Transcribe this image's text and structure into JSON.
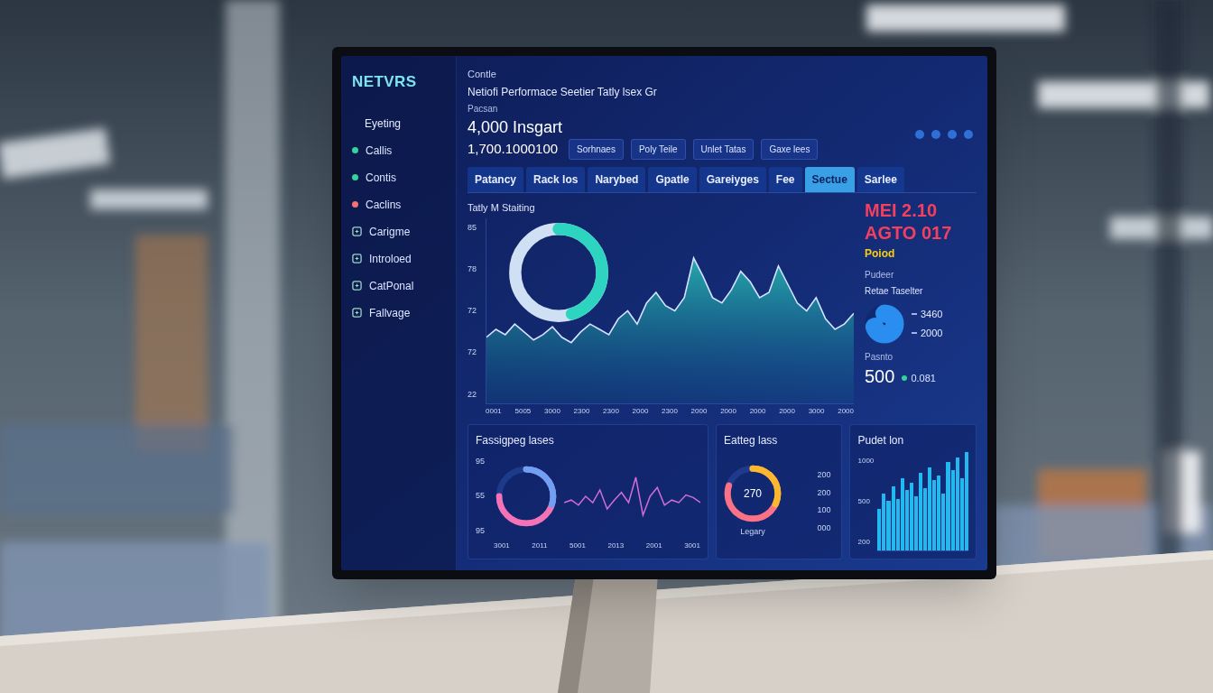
{
  "app": {
    "logo": "NETVRS"
  },
  "sidebar": {
    "items": [
      {
        "label": "Eyeting",
        "kind": "text"
      },
      {
        "label": "Callis",
        "kind": "dot",
        "color": "#34d399"
      },
      {
        "label": "Contis",
        "kind": "dot",
        "color": "#34d399"
      },
      {
        "label": "Caclins",
        "kind": "dot",
        "color": "#f87171"
      },
      {
        "label": "Carigme",
        "kind": "icon"
      },
      {
        "label": "Introloed",
        "kind": "icon"
      },
      {
        "label": "CatPonal",
        "kind": "icon"
      },
      {
        "label": "Fallvage",
        "kind": "icon"
      }
    ]
  },
  "header": {
    "title": "Contle",
    "subtitle": "Netiofi Performace Seetier Tatly lsex Gr",
    "label": "Pacsan",
    "value1": "4,000 Insgart",
    "value2": "1,700.1000100",
    "buttons": [
      "Sorhnaes",
      "Poly Teile",
      "Unlet Tatas",
      "Gaxe lees"
    ]
  },
  "tabs": [
    {
      "label": "Patancy",
      "selected": false
    },
    {
      "label": "Rack los",
      "selected": false
    },
    {
      "label": "Narybed",
      "selected": false
    },
    {
      "label": "Gpatle",
      "selected": false
    },
    {
      "label": "Gareiyges",
      "selected": false
    },
    {
      "label": "Fee",
      "selected": false
    },
    {
      "label": "Sectue",
      "selected": true
    },
    {
      "label": "Sarlee",
      "selected": false
    }
  ],
  "main_chart": {
    "title": "Tatly M Staiting",
    "y_ticks": [
      "85",
      "78",
      "72",
      "72",
      "22"
    ],
    "x_ticks": [
      "0001",
      "5005",
      "3000",
      "2300",
      "2300",
      "2000",
      "2300",
      "2000",
      "2000",
      "2000",
      "2000",
      "3000",
      "2000"
    ],
    "ring_level": 0.45,
    "series": [
      {
        "values": [
          45,
          48,
          46,
          50,
          47,
          44,
          46,
          49,
          45,
          43,
          47,
          50,
          48,
          46,
          52,
          55,
          50,
          58,
          62,
          57,
          55,
          60,
          75,
          68,
          60,
          58,
          63,
          70,
          66,
          60,
          62,
          72,
          65,
          58,
          55,
          60,
          52,
          48,
          50,
          54
        ]
      }
    ]
  },
  "right_panel": {
    "headline1": "MEI 2.10",
    "headline2": "AGTO 017",
    "badge": "Poiod",
    "label": "Pudeer",
    "sublabel": "Retae Taselter",
    "pie_level": 0.7,
    "stats": [
      "3460",
      "2000"
    ],
    "caption": "Pasnto",
    "big": "500",
    "small": "0.081"
  },
  "bottom_left": {
    "title": "Fassigpeg lases",
    "y_ticks": [
      "95",
      "55",
      "95"
    ],
    "donut_level": 0.75,
    "x_ticks": [
      "3001",
      "2011",
      "5001",
      "2013",
      "2001",
      "3001"
    ],
    "series": [
      {
        "values": [
          50,
          52,
          48,
          55,
          50,
          60,
          45,
          52,
          58,
          50,
          70,
          40,
          55,
          62,
          48,
          52,
          50,
          56,
          54,
          50
        ]
      }
    ]
  },
  "bottom_middle": {
    "title": "Eatteg lass",
    "center": "270",
    "label": "Legary",
    "donut_level": 0.8,
    "ticks": [
      "200",
      "200",
      "100",
      "000"
    ]
  },
  "bottom_right": {
    "title": "Pudet lon",
    "ticks": [
      "1000",
      "500",
      "200"
    ],
    "series": [
      {
        "values": [
          40,
          55,
          48,
          62,
          50,
          70,
          58,
          65,
          52,
          75,
          60,
          80,
          68,
          72,
          55,
          85,
          78,
          90,
          70,
          95
        ]
      }
    ]
  }
}
